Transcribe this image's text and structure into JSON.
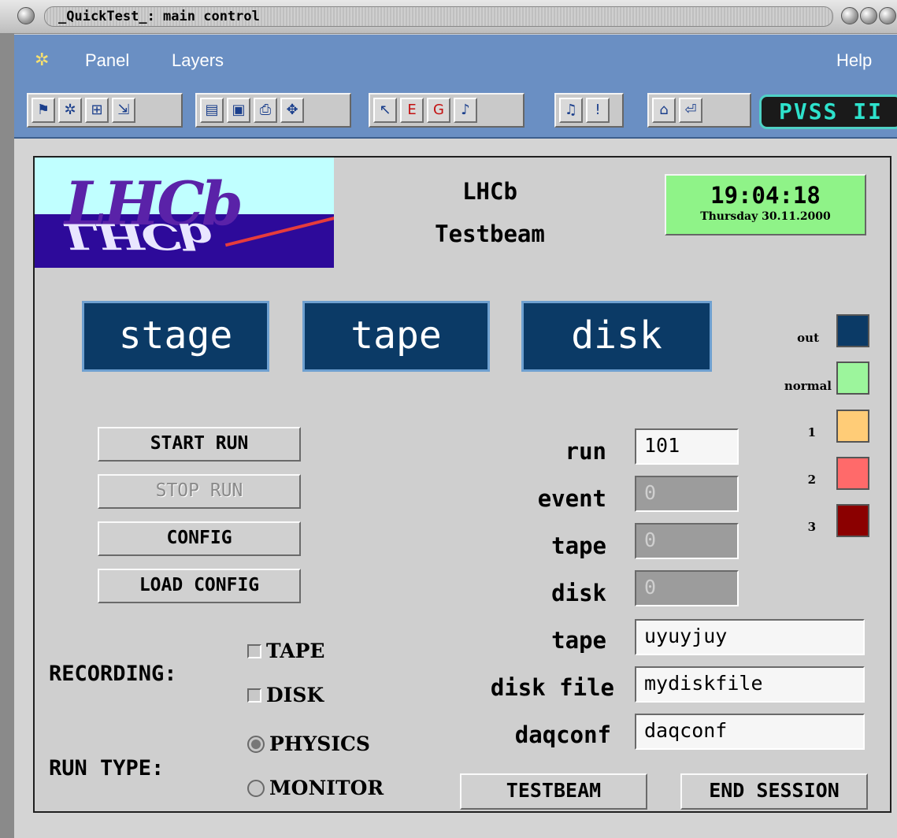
{
  "window": {
    "title": "_QuickTest_: main control"
  },
  "menubar": {
    "items": [
      "Panel",
      "Layers"
    ],
    "help": "Help"
  },
  "toolbar": {
    "brand": "PVSS II"
  },
  "header": {
    "logo_text": "LHCb",
    "title_line1": "LHCb",
    "title_line2": "Testbeam",
    "time": "19:04:18",
    "date": "Thursday 30.11.2000"
  },
  "destinations": [
    "stage",
    "tape",
    "disk"
  ],
  "legend": {
    "items": [
      {
        "label": "out",
        "color": "#0b3a66"
      },
      {
        "label": "normal",
        "color": "#9cf59c"
      },
      {
        "label": "1",
        "color": "#ffcc77"
      },
      {
        "label": "2",
        "color": "#ff6a6a"
      },
      {
        "label": "3",
        "color": "#8b0000"
      }
    ]
  },
  "commands": {
    "start_run": "START RUN",
    "stop_run": "STOP RUN",
    "config": "CONFIG",
    "load_config": "LOAD CONFIG"
  },
  "fields": {
    "run": {
      "label": "run",
      "value": "101"
    },
    "event": {
      "label": "event",
      "value": "0"
    },
    "tape_count": {
      "label": "tape",
      "value": "0"
    },
    "disk_count": {
      "label": "disk",
      "value": "0"
    },
    "tape_name": {
      "label": "tape",
      "value": "uyuyjuy"
    },
    "disk_file": {
      "label": "disk file",
      "value": "mydiskfile"
    },
    "daqconf": {
      "label": "daqconf",
      "value": "daqconf"
    }
  },
  "recording": {
    "label": "RECORDING:",
    "options": [
      "TAPE",
      "DISK"
    ]
  },
  "run_type": {
    "label": "RUN TYPE:",
    "options": [
      "PHYSICS",
      "MONITOR"
    ],
    "selected": "PHYSICS"
  },
  "footer": {
    "testbeam": "TESTBEAM",
    "end_session": "END SESSION"
  }
}
